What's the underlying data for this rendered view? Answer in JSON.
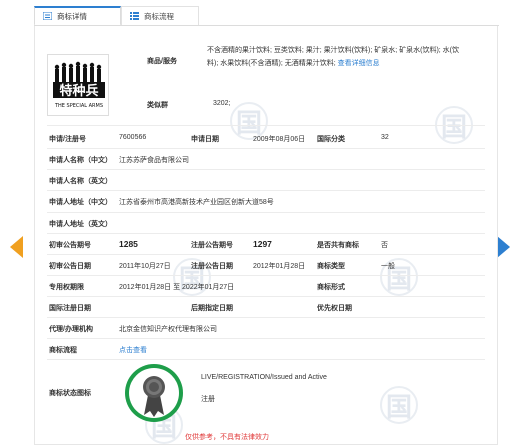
{
  "tabs": {
    "details": "商标详情",
    "flow": "商标流程"
  },
  "header": {
    "goods_label": "商品/服务",
    "goods_text_line1": "不含酒精的果汁饮料; 豆类饮料; 果汁; 果汁饮料(饮料); 矿泉水; 矿泉水(饮料); 水(饮",
    "goods_text_line2": "料); 水果饮料(不含酒精); 无酒精果汁饮料;",
    "goods_link": "查看详细信息",
    "similar_label": "类似群",
    "similar_value": "3202;",
    "logo_text_cn": "特种兵",
    "logo_text_en": "THE SPECIAL ARMS"
  },
  "rows": {
    "reg_no_label": "申请/注册号",
    "reg_no": "7600566",
    "apply_date_label": "申请日期",
    "apply_date": "2009年08月06日",
    "class_label": "国际分类",
    "class_value": "32",
    "applicant_cn_label": "申请人名称（中文）",
    "applicant_cn": "江苏苏萨食品有限公司",
    "applicant_en_label": "申请人名称（英文）",
    "address_cn_label": "申请人地址（中文）",
    "address_cn": "江苏省泰州市高港高新技术产业园区创新大道58号",
    "address_en_label": "申请人地址（英文）",
    "first_pub_no_label": "初审公告期号",
    "first_pub_no": "1285",
    "reg_pub_no_label": "注册公告期号",
    "reg_pub_no": "1297",
    "shared_label": "是否共有商标",
    "shared_value": "否",
    "first_pub_date_label": "初审公告日期",
    "first_pub_date": "2011年10月27日",
    "reg_pub_date_label": "注册公告日期",
    "reg_pub_date": "2012年01月28日",
    "type_label": "商标类型",
    "type_value": "一般",
    "period_label": "专用权期限",
    "period_value": "2012年01月28日 至 2022年01月27日",
    "form_label": "商标形式",
    "intl_reg_label": "国际注册日期",
    "later_label": "后期指定日期",
    "priority_label": "优先权日期",
    "agent_label": "代理/办理机构",
    "agent_value": "北京金信知识产权代理有限公司",
    "flow_label": "商标流程",
    "flow_link": "点击查看",
    "status_label": "商标状态图标",
    "status_en": "LIVE/REGISTRATION/Issued and Active",
    "status_cn": "注册"
  },
  "note": "仅供参考，不具有法律效力",
  "watermark_char": "国",
  "colors": {
    "accent": "#2d7fd0",
    "arrow_left": "#f0a020",
    "arrow_right": "#2d7fd0",
    "badge": "#1e9e4a",
    "note": "#e03a3a"
  }
}
